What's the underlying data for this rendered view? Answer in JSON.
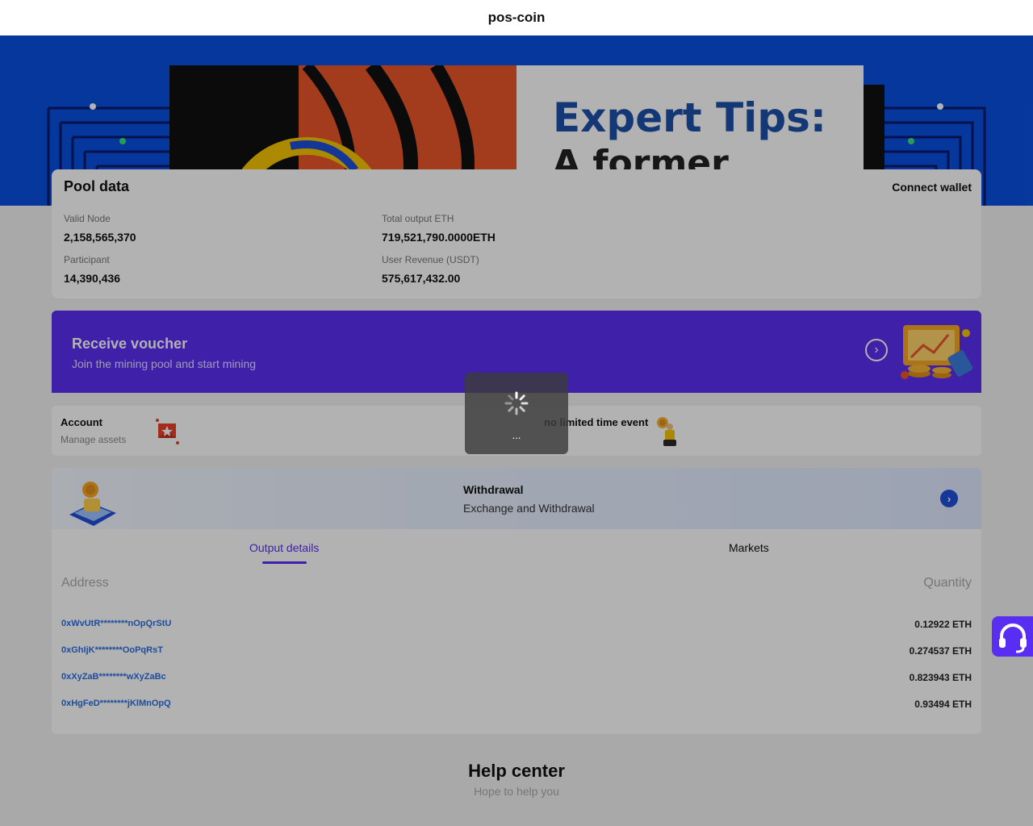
{
  "header": {
    "title": "pos-coin"
  },
  "banner": {
    "headline": "Expert Tips:",
    "subline": "A former"
  },
  "pool": {
    "heading": "Pool data",
    "connect_label": "Connect wallet",
    "stats": [
      {
        "label": "Valid Node",
        "value": "2,158,565,370"
      },
      {
        "label": "Total output ETH",
        "value": "719,521,790.0000ETH"
      },
      {
        "label": "Participant",
        "value": "14,390,436"
      },
      {
        "label": "User Revenue (USDT)",
        "value": "575,617,432.00"
      }
    ]
  },
  "voucher": {
    "title": "Receive voucher",
    "subtitle": "Join the mining pool and start mining",
    "arrow_icon": "chevron-right-circle-icon"
  },
  "features": {
    "account_title": "Account",
    "account_subtitle": "Manage assets",
    "event_title": "no limited time event"
  },
  "withdraw": {
    "title": "Withdrawal",
    "subtitle": "Exchange and Withdrawal"
  },
  "details": {
    "tabs": [
      {
        "label": "Output details",
        "active": true
      },
      {
        "label": "Markets",
        "active": false
      }
    ],
    "col_address": "Address",
    "col_quantity": "Quantity",
    "rows": [
      {
        "address": "0xWvUtR********nOpQrStU",
        "quantity": "0.12922 ETH"
      },
      {
        "address": "0xGhIjK********OoPqRsT",
        "quantity": "0.274537 ETH"
      },
      {
        "address": "0xXyZaB********wXyZaBc",
        "quantity": "0.823943 ETH"
      },
      {
        "address": "0xHgFeD********jKlMnOpQ",
        "quantity": "0.93494 ETH"
      }
    ]
  },
  "help": {
    "title": "Help center",
    "subtitle": "Hope to help you"
  },
  "loader": {
    "text": "..."
  },
  "colors": {
    "primary": "#5a2ef2",
    "banner_blue": "#0a50e0",
    "link_blue": "#2b6fe0"
  }
}
